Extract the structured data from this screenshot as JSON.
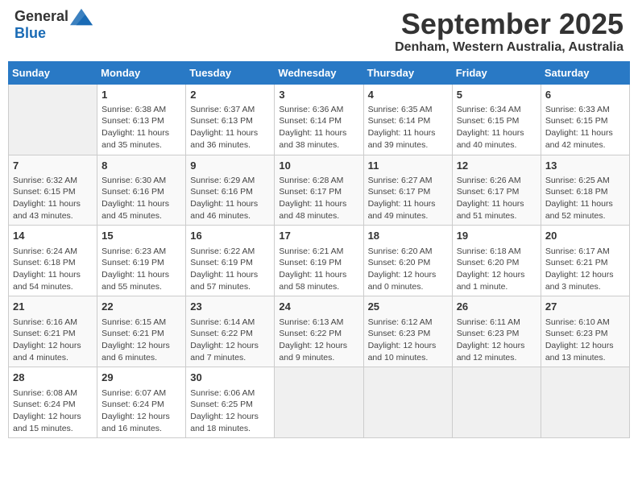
{
  "header": {
    "logo_line1": "General",
    "logo_line2": "Blue",
    "month": "September 2025",
    "location": "Denham, Western Australia, Australia"
  },
  "weekdays": [
    "Sunday",
    "Monday",
    "Tuesday",
    "Wednesday",
    "Thursday",
    "Friday",
    "Saturday"
  ],
  "weeks": [
    [
      {
        "day": "",
        "empty": true
      },
      {
        "day": "1",
        "sunrise": "Sunrise: 6:38 AM",
        "sunset": "Sunset: 6:13 PM",
        "daylight": "Daylight: 11 hours and 35 minutes."
      },
      {
        "day": "2",
        "sunrise": "Sunrise: 6:37 AM",
        "sunset": "Sunset: 6:13 PM",
        "daylight": "Daylight: 11 hours and 36 minutes."
      },
      {
        "day": "3",
        "sunrise": "Sunrise: 6:36 AM",
        "sunset": "Sunset: 6:14 PM",
        "daylight": "Daylight: 11 hours and 38 minutes."
      },
      {
        "day": "4",
        "sunrise": "Sunrise: 6:35 AM",
        "sunset": "Sunset: 6:14 PM",
        "daylight": "Daylight: 11 hours and 39 minutes."
      },
      {
        "day": "5",
        "sunrise": "Sunrise: 6:34 AM",
        "sunset": "Sunset: 6:15 PM",
        "daylight": "Daylight: 11 hours and 40 minutes."
      },
      {
        "day": "6",
        "sunrise": "Sunrise: 6:33 AM",
        "sunset": "Sunset: 6:15 PM",
        "daylight": "Daylight: 11 hours and 42 minutes."
      }
    ],
    [
      {
        "day": "7",
        "sunrise": "Sunrise: 6:32 AM",
        "sunset": "Sunset: 6:15 PM",
        "daylight": "Daylight: 11 hours and 43 minutes."
      },
      {
        "day": "8",
        "sunrise": "Sunrise: 6:30 AM",
        "sunset": "Sunset: 6:16 PM",
        "daylight": "Daylight: 11 hours and 45 minutes."
      },
      {
        "day": "9",
        "sunrise": "Sunrise: 6:29 AM",
        "sunset": "Sunset: 6:16 PM",
        "daylight": "Daylight: 11 hours and 46 minutes."
      },
      {
        "day": "10",
        "sunrise": "Sunrise: 6:28 AM",
        "sunset": "Sunset: 6:17 PM",
        "daylight": "Daylight: 11 hours and 48 minutes."
      },
      {
        "day": "11",
        "sunrise": "Sunrise: 6:27 AM",
        "sunset": "Sunset: 6:17 PM",
        "daylight": "Daylight: 11 hours and 49 minutes."
      },
      {
        "day": "12",
        "sunrise": "Sunrise: 6:26 AM",
        "sunset": "Sunset: 6:17 PM",
        "daylight": "Daylight: 11 hours and 51 minutes."
      },
      {
        "day": "13",
        "sunrise": "Sunrise: 6:25 AM",
        "sunset": "Sunset: 6:18 PM",
        "daylight": "Daylight: 11 hours and 52 minutes."
      }
    ],
    [
      {
        "day": "14",
        "sunrise": "Sunrise: 6:24 AM",
        "sunset": "Sunset: 6:18 PM",
        "daylight": "Daylight: 11 hours and 54 minutes."
      },
      {
        "day": "15",
        "sunrise": "Sunrise: 6:23 AM",
        "sunset": "Sunset: 6:19 PM",
        "daylight": "Daylight: 11 hours and 55 minutes."
      },
      {
        "day": "16",
        "sunrise": "Sunrise: 6:22 AM",
        "sunset": "Sunset: 6:19 PM",
        "daylight": "Daylight: 11 hours and 57 minutes."
      },
      {
        "day": "17",
        "sunrise": "Sunrise: 6:21 AM",
        "sunset": "Sunset: 6:19 PM",
        "daylight": "Daylight: 11 hours and 58 minutes."
      },
      {
        "day": "18",
        "sunrise": "Sunrise: 6:20 AM",
        "sunset": "Sunset: 6:20 PM",
        "daylight": "Daylight: 12 hours and 0 minutes."
      },
      {
        "day": "19",
        "sunrise": "Sunrise: 6:18 AM",
        "sunset": "Sunset: 6:20 PM",
        "daylight": "Daylight: 12 hours and 1 minute."
      },
      {
        "day": "20",
        "sunrise": "Sunrise: 6:17 AM",
        "sunset": "Sunset: 6:21 PM",
        "daylight": "Daylight: 12 hours and 3 minutes."
      }
    ],
    [
      {
        "day": "21",
        "sunrise": "Sunrise: 6:16 AM",
        "sunset": "Sunset: 6:21 PM",
        "daylight": "Daylight: 12 hours and 4 minutes."
      },
      {
        "day": "22",
        "sunrise": "Sunrise: 6:15 AM",
        "sunset": "Sunset: 6:21 PM",
        "daylight": "Daylight: 12 hours and 6 minutes."
      },
      {
        "day": "23",
        "sunrise": "Sunrise: 6:14 AM",
        "sunset": "Sunset: 6:22 PM",
        "daylight": "Daylight: 12 hours and 7 minutes."
      },
      {
        "day": "24",
        "sunrise": "Sunrise: 6:13 AM",
        "sunset": "Sunset: 6:22 PM",
        "daylight": "Daylight: 12 hours and 9 minutes."
      },
      {
        "day": "25",
        "sunrise": "Sunrise: 6:12 AM",
        "sunset": "Sunset: 6:23 PM",
        "daylight": "Daylight: 12 hours and 10 minutes."
      },
      {
        "day": "26",
        "sunrise": "Sunrise: 6:11 AM",
        "sunset": "Sunset: 6:23 PM",
        "daylight": "Daylight: 12 hours and 12 minutes."
      },
      {
        "day": "27",
        "sunrise": "Sunrise: 6:10 AM",
        "sunset": "Sunset: 6:23 PM",
        "daylight": "Daylight: 12 hours and 13 minutes."
      }
    ],
    [
      {
        "day": "28",
        "sunrise": "Sunrise: 6:08 AM",
        "sunset": "Sunset: 6:24 PM",
        "daylight": "Daylight: 12 hours and 15 minutes."
      },
      {
        "day": "29",
        "sunrise": "Sunrise: 6:07 AM",
        "sunset": "Sunset: 6:24 PM",
        "daylight": "Daylight: 12 hours and 16 minutes."
      },
      {
        "day": "30",
        "sunrise": "Sunrise: 6:06 AM",
        "sunset": "Sunset: 6:25 PM",
        "daylight": "Daylight: 12 hours and 18 minutes."
      },
      {
        "day": "",
        "empty": true
      },
      {
        "day": "",
        "empty": true
      },
      {
        "day": "",
        "empty": true
      },
      {
        "day": "",
        "empty": true
      }
    ]
  ]
}
